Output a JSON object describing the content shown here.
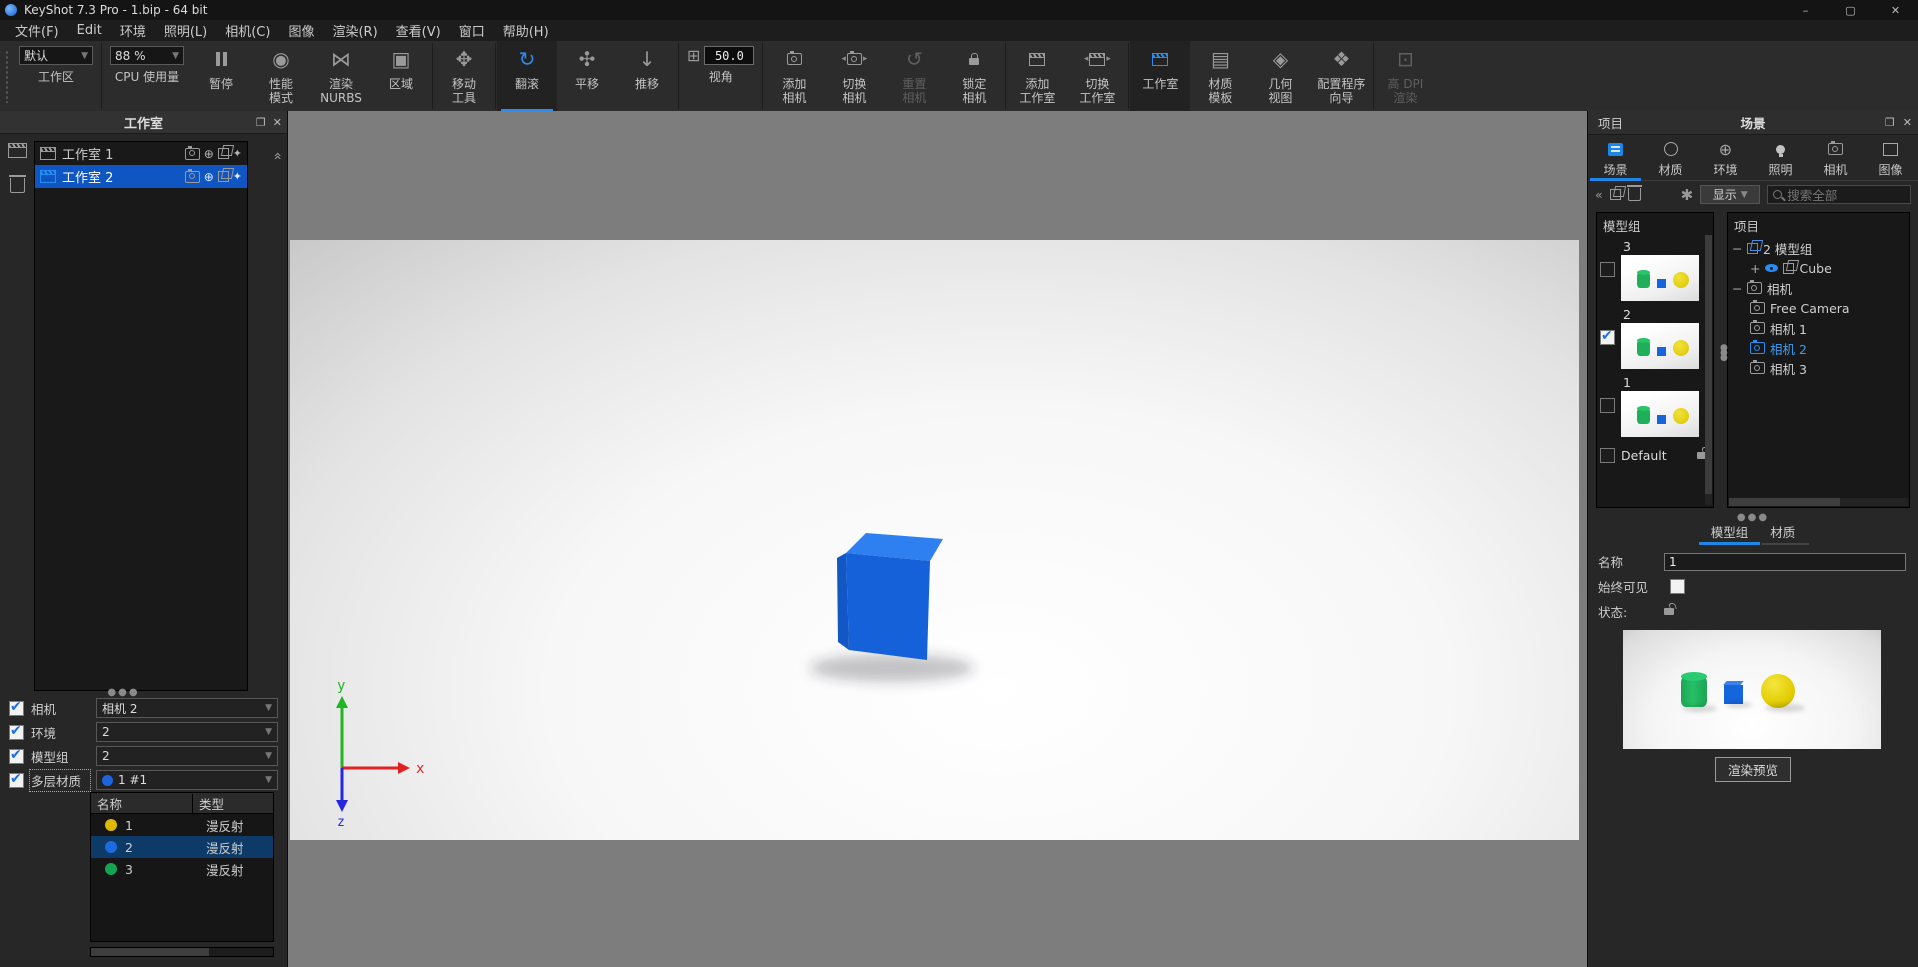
{
  "window": {
    "title": "KeyShot 7.3 Pro  - 1.bip  - 64 bit",
    "minimize": "–",
    "maximize": "▢",
    "close": "✕",
    "menus": [
      "文件(F)",
      "Edit",
      "环境",
      "照明(L)",
      "相机(C)",
      "图像",
      "渲染(R)",
      "查看(V)",
      "窗口",
      "帮助(H)"
    ]
  },
  "toolbar": {
    "workspace": {
      "value": "默认",
      "label": "工作区"
    },
    "cpu": {
      "value": "88 %",
      "label": "CPU 使用量"
    },
    "fov": {
      "value": "50.0",
      "label": "视角"
    },
    "buttons": [
      {
        "l1": "暂停"
      },
      {
        "l1": "性能",
        "l2": "模式"
      },
      {
        "l1": "渲染",
        "l2": "NURBS"
      },
      {
        "l1": "区域"
      },
      {
        "l1": "移动",
        "l2": "工具"
      },
      {
        "l1": "翻滚"
      },
      {
        "l1": "平移"
      },
      {
        "l1": "推移"
      },
      {
        "l1": "添加",
        "l2": "相机"
      },
      {
        "l1": "切换",
        "l2": "相机"
      },
      {
        "l1": "重置",
        "l2": "相机"
      },
      {
        "l1": "锁定",
        "l2": "相机"
      },
      {
        "l1": "添加",
        "l2": "工作室"
      },
      {
        "l1": "切换",
        "l2": "工作室"
      },
      {
        "l1": "工作室"
      },
      {
        "l1": "材质",
        "l2": "模板"
      },
      {
        "l1": "几何",
        "l2": "视图"
      },
      {
        "l1": "配置程序",
        "l2": "向导"
      },
      {
        "l1": "高 DPI",
        "l2": "渲染"
      }
    ]
  },
  "studio_panel": {
    "title": "工作室",
    "items": [
      {
        "label": "工作室 1"
      },
      {
        "label": "工作室 2"
      }
    ],
    "rows": [
      {
        "label": "相机",
        "value": "相机 2"
      },
      {
        "label": "环境",
        "value": "2"
      },
      {
        "label": "模型组",
        "value": "2"
      },
      {
        "label": "多层材质",
        "value": "1 #1"
      }
    ],
    "table": {
      "name_header": "名称",
      "type_header": "类型",
      "rows": [
        {
          "name": "1",
          "type": "漫反射",
          "dot": "#ddb900"
        },
        {
          "name": "2",
          "type": "漫反射",
          "dot": "#1c6be0"
        },
        {
          "name": "3",
          "type": "漫反射",
          "dot": "#17a452"
        }
      ]
    }
  },
  "viewport": {
    "axis_x": "x",
    "axis_y": "y",
    "axis_z": "z"
  },
  "project_panel": {
    "left_tab": "项目",
    "title": "场景",
    "tabs": [
      {
        "label": "场景"
      },
      {
        "label": "材质"
      },
      {
        "label": "环境"
      },
      {
        "label": "照明"
      },
      {
        "label": "相机"
      },
      {
        "label": "图像"
      }
    ],
    "collapse": "«",
    "filter_label": "显示",
    "search_placeholder": "搜索全部",
    "model_sets": {
      "header": "模型组",
      "items": [
        {
          "label": "3",
          "checked": false
        },
        {
          "label": "2",
          "checked": true
        },
        {
          "label": "1",
          "checked": false
        },
        {
          "label": "Default",
          "checked": false
        }
      ]
    },
    "tree": {
      "header": "项目",
      "nodes": [
        {
          "label": "2 模型组"
        },
        {
          "label": "Cube"
        },
        {
          "label": "相机"
        },
        {
          "label": "Free Camera"
        },
        {
          "label": "相机 1"
        },
        {
          "label": "相机 2"
        },
        {
          "label": "相机 3"
        }
      ]
    },
    "bottom_tabs": [
      {
        "label": "模型组"
      },
      {
        "label": "材质"
      }
    ],
    "name_label": "名称",
    "name_value": "1",
    "always_visible_label": "始终可见",
    "state_label": "状态:",
    "render_preview_label": "渲染预览"
  },
  "colors": {
    "accent": "#1f86e8",
    "selection": "#0f56c3",
    "table_selection": "#0d3a67",
    "cube_front": "#1561da",
    "cube_top": "#2e7ff0",
    "preview_green": "#1fae5a",
    "preview_blue": "#1565dd",
    "preview_yellow": "#e0cc00"
  }
}
